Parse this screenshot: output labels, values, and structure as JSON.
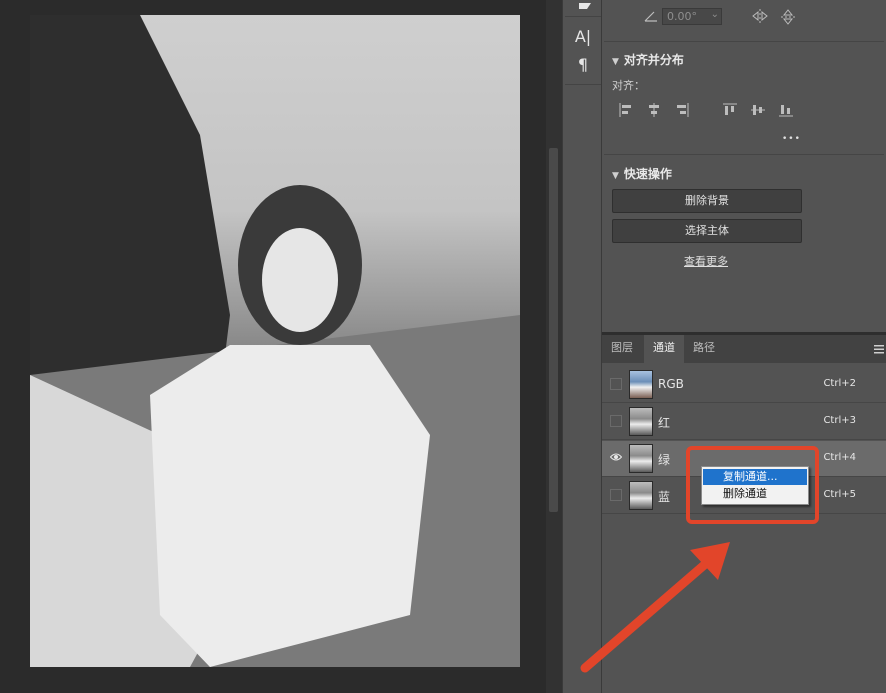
{
  "props": {
    "angle_value": "0.00°",
    "align_title": "对齐并分布",
    "align_label": "对齐：",
    "more": "•••",
    "quick_title": "快速操作",
    "remove_bg": "删除背景",
    "select_subject": "选择主体",
    "view_more": "查看更多"
  },
  "panel": {
    "tabs": [
      "图层",
      "通道",
      "路径"
    ],
    "active_tab": 1,
    "menu_icon": "panel-menu-icon"
  },
  "channels": [
    {
      "name": "RGB",
      "shortcut": "Ctrl+2",
      "visible": false,
      "selected": false
    },
    {
      "name": "红",
      "shortcut": "Ctrl+3",
      "visible": false,
      "selected": false
    },
    {
      "name": "绿",
      "shortcut": "Ctrl+4",
      "visible": true,
      "selected": true
    },
    {
      "name": "蓝",
      "shortcut": "Ctrl+5",
      "visible": false,
      "selected": false
    }
  ],
  "context_menu": {
    "items": [
      "复制通道...",
      "删除通道"
    ],
    "highlighted": 0
  },
  "tools": {
    "icons": [
      "character-panel-icon",
      "text-panel-icon",
      "paragraph-icon"
    ],
    "glyphs": [
      "A|",
      "¶"
    ]
  },
  "colors": {
    "annotation": "#e2452a",
    "menu_highlight": "#1f73cc"
  }
}
